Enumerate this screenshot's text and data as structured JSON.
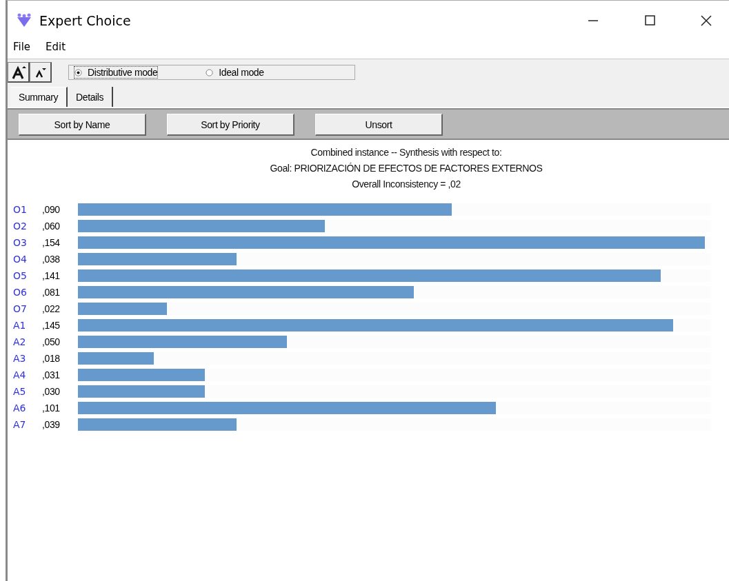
{
  "window": {
    "title": "Expert Choice"
  },
  "menu": [
    "File",
    "Edit"
  ],
  "modes": [
    {
      "label": "Distributive mode",
      "selected": true
    },
    {
      "label": "Ideal mode",
      "selected": false
    }
  ],
  "tabs": [
    {
      "label": "Summary",
      "selected": true
    },
    {
      "label": "Details",
      "selected": false
    }
  ],
  "sort_buttons": [
    "Sort by Name",
    "Sort by Priority",
    "Unsort"
  ],
  "heading": [
    "Combined instance -- Synthesis with respect to:",
    "Goal: PRIORIZACIÓN DE EFECTOS DE FACTORES EXTERNOS",
    "Overall Inconsistency = ,02"
  ],
  "rows": [
    {
      "name": "O1",
      "value": ",090",
      "level": 0.59
    },
    {
      "name": "O2",
      "value": ",060",
      "level": 0.39
    },
    {
      "name": "O3",
      "value": ",154",
      "level": 0.99
    },
    {
      "name": "O4",
      "value": ",038",
      "level": 0.25
    },
    {
      "name": "O5",
      "value": ",141",
      "level": 0.92
    },
    {
      "name": "O6",
      "value": ",081",
      "level": 0.53
    },
    {
      "name": "O7",
      "value": ",022",
      "level": 0.14
    },
    {
      "name": "A1",
      "value": ",145",
      "level": 0.94
    },
    {
      "name": "A2",
      "value": ",050",
      "level": 0.33
    },
    {
      "name": "A3",
      "value": ",018",
      "level": 0.12
    },
    {
      "name": "A4",
      "value": ",031",
      "level": 0.2
    },
    {
      "name": "A5",
      "value": ",030",
      "level": 0.2
    },
    {
      "name": "A6",
      "value": ",101",
      "level": 0.66
    },
    {
      "name": "A7",
      "value": ",039",
      "level": 0.25
    }
  ]
}
